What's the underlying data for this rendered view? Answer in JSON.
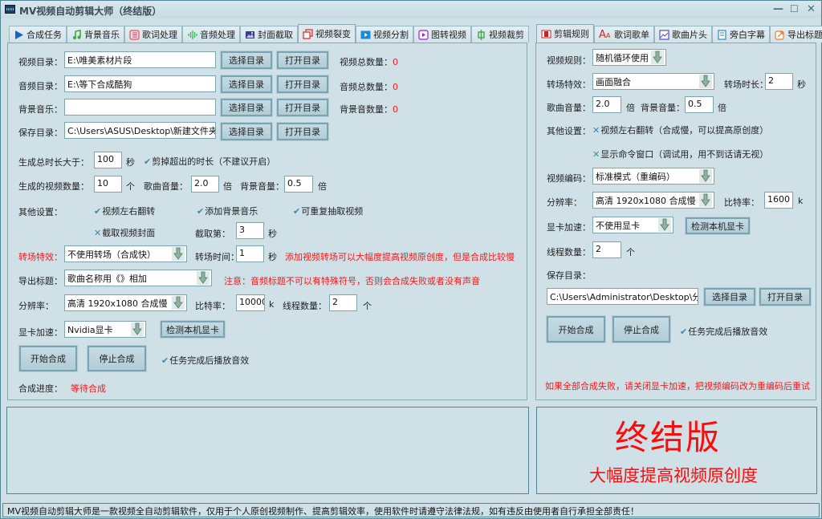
{
  "window": {
    "title": "MV视频自动剪辑大师（终结版）",
    "controls": {
      "minimize": "—",
      "maximize": "☐",
      "close": "✕"
    }
  },
  "left_tabs": [
    {
      "label": "合成任务",
      "icon": "play-icon"
    },
    {
      "label": "背景音乐",
      "icon": "music-note-icon"
    },
    {
      "label": "歌词处理",
      "icon": "lyrics-icon"
    },
    {
      "label": "音频处理",
      "icon": "audio-wave-icon"
    },
    {
      "label": "封面截取",
      "icon": "image-icon"
    },
    {
      "label": "视频裂变",
      "icon": "copy-icon",
      "active": true
    },
    {
      "label": "视频分割",
      "icon": "video-split-icon"
    },
    {
      "label": "图转视频",
      "icon": "image-to-video-icon"
    },
    {
      "label": "视频裁剪",
      "icon": "crop-icon"
    }
  ],
  "right_tabs": [
    {
      "label": "剪辑规则",
      "icon": "rules-icon",
      "active": true
    },
    {
      "label": "歌词歌单",
      "icon": "font-icon"
    },
    {
      "label": "歌曲片头",
      "icon": "picture-icon"
    },
    {
      "label": "旁白字幕",
      "icon": "subtitle-icon"
    },
    {
      "label": "导出标题",
      "icon": "export-icon"
    }
  ],
  "left": {
    "dirs": [
      {
        "label": "视频目录：",
        "value": "E:\\唯美素材片段",
        "count_label": "视频总数量：",
        "count": "0"
      },
      {
        "label": "音频目录：",
        "value": "E:\\等下合成酷狗",
        "count_label": "音频总数量：",
        "count": "0"
      },
      {
        "label": "背景音乐：",
        "value": "",
        "count_label": "背景音数量：",
        "count": "0"
      },
      {
        "label": "保存目录：",
        "value": "C:\\Users\\ASUS\\Desktop\\新建文件夹",
        "count_label": "",
        "count": ""
      }
    ],
    "choose_dir": "选择目录",
    "open_dir": "打开目录",
    "total_duration_label": "生成总时长大于：",
    "total_duration": "100",
    "sec": "秒",
    "cut_excess": "剪掉超出的时长（不建议开启）",
    "video_count_label": "生成的视频数量：",
    "video_count": "10",
    "unit_ge": "个",
    "song_volume_label": "歌曲音量：",
    "song_volume": "2.0",
    "times": "倍",
    "bg_volume_label": "背景音量：",
    "bg_volume": "0.5",
    "other_settings_label": "其他设置：",
    "opt_flip": "视频左右翻转",
    "opt_bgm": "添加背景音乐",
    "opt_repeat": "可重复抽取视频",
    "opt_cover": "截取视频封面",
    "capture_at_label": "截取第：",
    "capture_at": "3",
    "transition_label": "转场特效：",
    "transition": "不使用转场（合成快）",
    "transition_time_label": "转场时间：",
    "transition_time": "1",
    "transition_hint": "添加视频转场可以大幅度提高视频原创度，但是合成比较慢",
    "export_title_label": "导出标题：",
    "export_title": "歌曲名称用《》相加",
    "export_hint": "注意：音频标题不可以有特殊符号，否则会合成失败或者没有声音",
    "resolution_label": "分辨率：",
    "resolution": "高清 1920x1080 合成慢",
    "bitrate_label": "比特率：",
    "bitrate": "10000",
    "k": "k",
    "threads_label": "线程数量：",
    "threads": "2",
    "gpu_label": "显卡加速：",
    "gpu": "Nvidia显卡",
    "detect_gpu": "检测本机显卡",
    "start": "开始合成",
    "stop": "停止合成",
    "play_sound": "任务完成后播放音效",
    "progress_label": "合成进度：",
    "progress_status": "等待合成"
  },
  "right": {
    "video_rule_label": "视频规则：",
    "video_rule": "随机循环使用",
    "transition_label": "转场特效：",
    "transition": "画面融合",
    "transition_len_label": "转场时长：",
    "transition_len": "2",
    "sec": "秒",
    "song_volume_label": "歌曲音量：",
    "song_volume": "2.0",
    "times": "倍",
    "bg_volume_label": "背景音量：",
    "bg_volume": "0.5",
    "other_settings_label": "其他设置：",
    "opt_flip": "视频左右翻转（合成慢，可以提高原创度）",
    "opt_cmd": "显示命令窗口（调试用，用不到话请无视）",
    "encode_label": "视频编码：",
    "encode": "标准模式（重编码）",
    "resolution_label": "分辨率：",
    "resolution": "高清 1920x1080 合成慢",
    "bitrate_label": "比特率：",
    "bitrate": "1600",
    "k": "k",
    "gpu_label": "显卡加速：",
    "gpu": "不使用显卡",
    "detect_gpu": "检测本机显卡",
    "threads_label": "线程数量：",
    "threads": "2",
    "unit_ge": "个",
    "save_dir_label": "保存目录：",
    "save_dir": "C:\\Users\\Administrator\\Desktop\\分割",
    "choose_dir": "选择目录",
    "open_dir": "打开目录",
    "start": "开始合成",
    "stop": "停止合成",
    "play_sound": "任务完成后播放音效",
    "fail_hint": "如果全部合成失败，请关闭显卡加速，把视频编码改为重编码后重试"
  },
  "promo": {
    "title": "终结版",
    "subtitle": "大幅度提高视频原创度"
  },
  "status_bar": "MV视频自动剪辑大师是一款视频全自动剪辑软件，仅用于个人原创视频制作、提高剪辑效率，使用软件时请遵守法律法规，如有违反由使用者自行承担全部责任！",
  "colors": {
    "background": "#cfe0e7",
    "border": "#4f8795",
    "warning_red": "#ee1c1c",
    "check_blue": "#3f87a8"
  }
}
